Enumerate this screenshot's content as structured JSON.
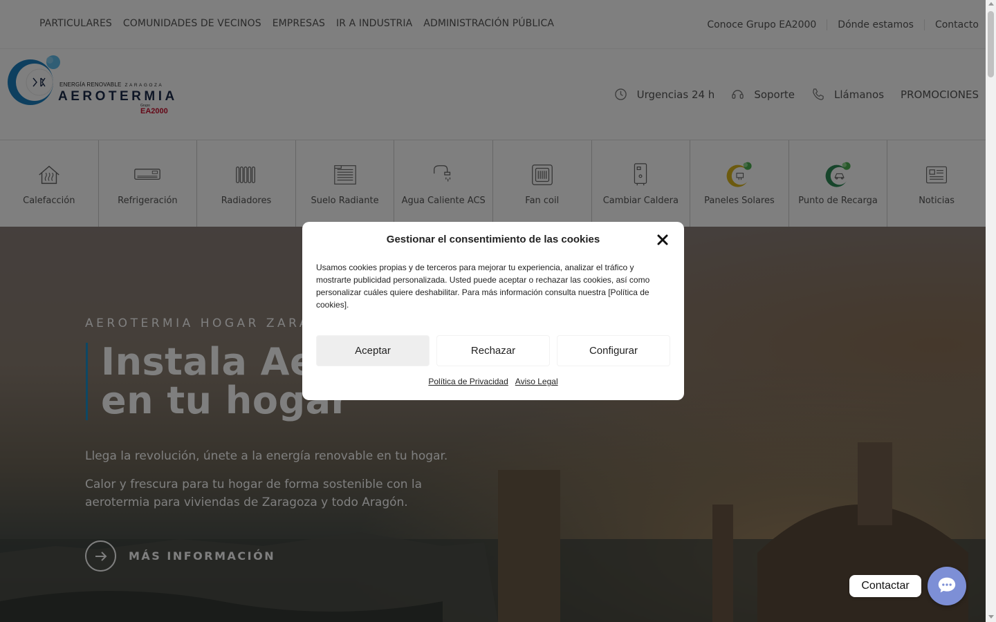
{
  "topbar": {
    "left_links": [
      "PARTICULARES",
      "COMUNIDADES DE VECINOS",
      "EMPRESAS",
      "IR A INDUSTRIA",
      "ADMINISTRACIÓN PÚBLICA"
    ],
    "right_links": [
      "Conoce Grupo EA2000",
      "Dónde estamos",
      "Contacto"
    ]
  },
  "logo": {
    "tagline": "ENERGÍA RENOVABLE",
    "city": "ZARAGOZA",
    "brand": "AEROTERMIA",
    "group_prefix": "Grupo",
    "group": "EA2000"
  },
  "header_actions": {
    "urgencias": "Urgencias 24 h",
    "soporte": "Soporte",
    "llamanos": "Llámanos",
    "promociones": "PROMOCIONES"
  },
  "categories": [
    {
      "label": "Calefacción",
      "icon": "house-heating-icon"
    },
    {
      "label": "Refrigeración",
      "icon": "air-conditioner-icon"
    },
    {
      "label": "Radiadores",
      "icon": "radiator-icon"
    },
    {
      "label": "Suelo Radiante",
      "icon": "floor-heating-icon"
    },
    {
      "label": "Agua Caliente ACS",
      "icon": "hot-water-tap-icon"
    },
    {
      "label": "Fan coil",
      "icon": "fan-coil-icon"
    },
    {
      "label": "Cambiar Caldera",
      "icon": "boiler-icon"
    },
    {
      "label": "Paneles Solares",
      "icon": "solar-panel-icon"
    },
    {
      "label": "Punto de Recarga",
      "icon": "ev-charger-icon"
    },
    {
      "label": "Noticias",
      "icon": "newspaper-icon"
    }
  ],
  "hero": {
    "eyebrow": "AEROTERMIA HOGAR ZARAGOZA",
    "title_line1": "Instala Aerotermia",
    "title_line2": "en tu hogar",
    "p1": "Llega la revolución, únete a la energía renovable en tu hogar.",
    "p2": "Calor y frescura para tu hogar de forma sostenible con la aerotermia para viviendas de Zaragoza y todo Aragón.",
    "cta": "MÁS INFORMACIÓN"
  },
  "cookie_modal": {
    "title": "Gestionar el consentimiento de las cookies",
    "body": "Usamos cookies propias y de terceros para mejorar tu experiencia, analizar el tráfico y mostrarte publicidad personalizada. Usted puede aceptar o rechazar las cookies, así como personalizar cuáles quiere deshabilitar. Para más información consulta nuestra [Política de cookies].",
    "accept": "Aceptar",
    "reject": "Rechazar",
    "configure": "Configurar",
    "privacy_link": "Política de Privacidad",
    "legal_link": "Aviso Legal"
  },
  "chat": {
    "label": "Contactar"
  },
  "colors": {
    "accent_blue": "#1a8fc9",
    "logo_navy": "#1b2a4a",
    "brand_red": "#c8102e",
    "chat_button": "#7d8fd6",
    "eco_green": "#4caf50"
  }
}
